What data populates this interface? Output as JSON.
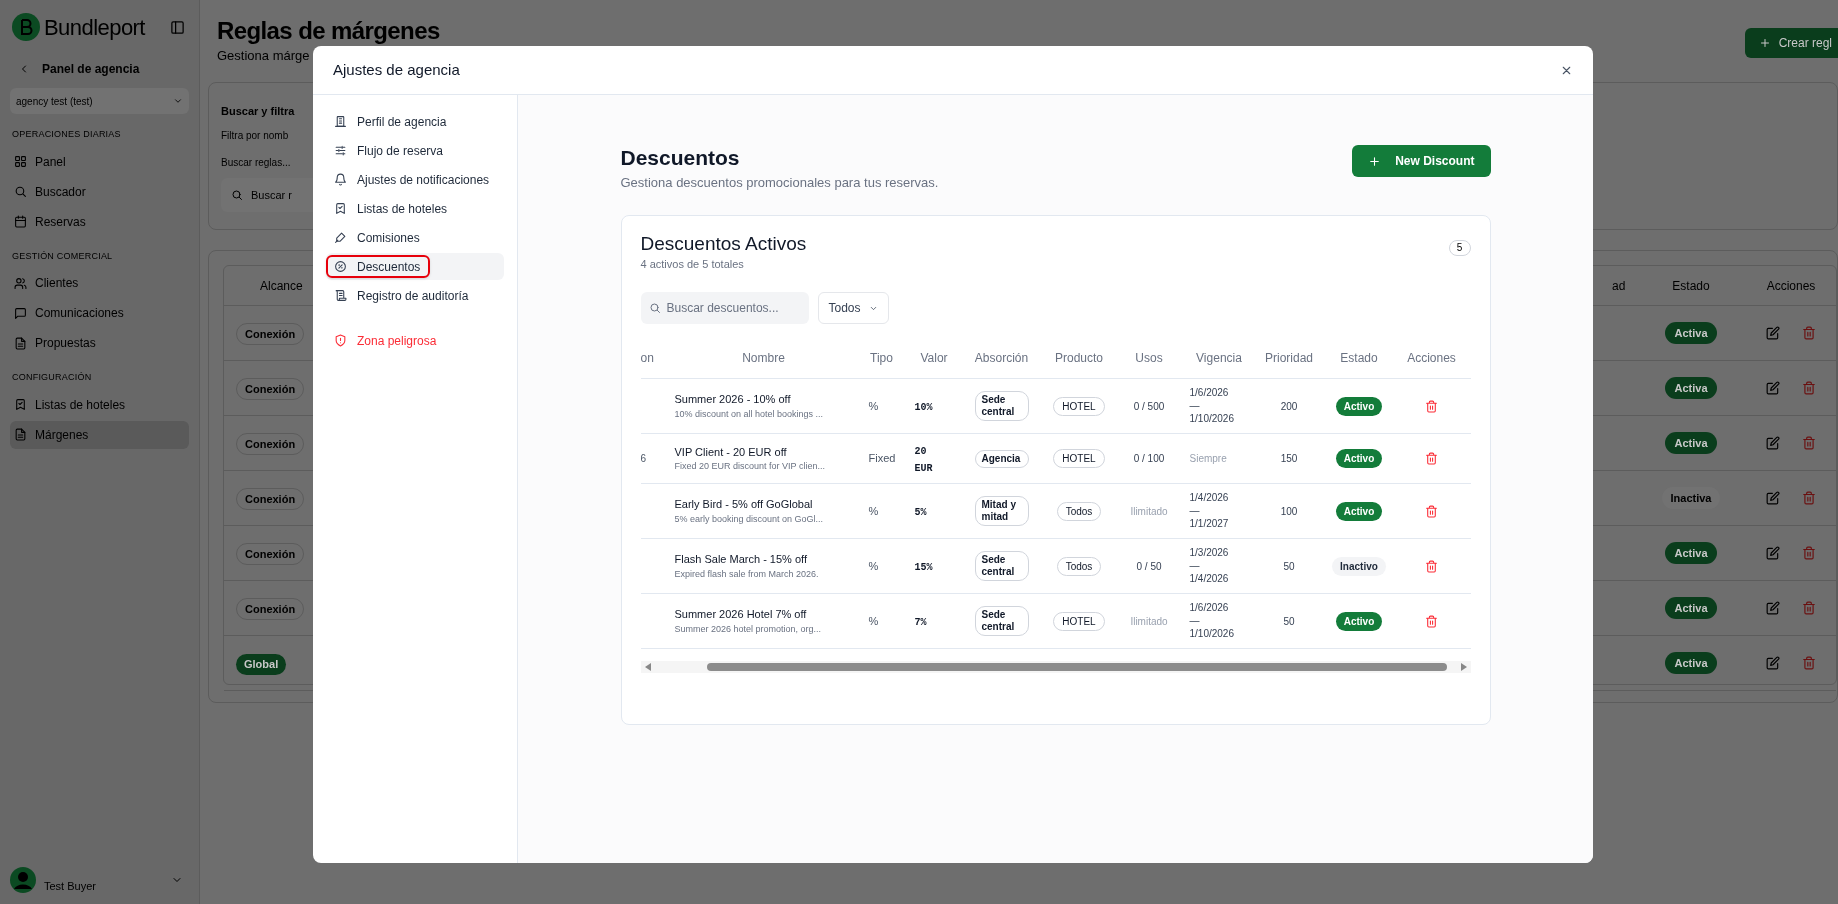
{
  "background": {
    "brand": "Bundleport",
    "back_link": "Panel de agencia",
    "agency_select": "agency test (test)",
    "nav_sections": [
      {
        "title": "OPERACIONES DIARIAS",
        "items": [
          {
            "label": "Panel",
            "selected": false
          },
          {
            "label": "Buscador",
            "selected": false
          },
          {
            "label": "Reservas",
            "selected": false
          }
        ]
      },
      {
        "title": "GESTIÓN COMERCIAL",
        "items": [
          {
            "label": "Clientes",
            "selected": false
          },
          {
            "label": "Comunicaciones",
            "selected": false
          },
          {
            "label": "Propuestas",
            "selected": false
          }
        ]
      },
      {
        "title": "CONFIGURACIÓN",
        "items": [
          {
            "label": "Listas de hoteles",
            "selected": false
          },
          {
            "label": "Márgenes",
            "selected": true
          }
        ]
      }
    ],
    "user": "Test Buyer",
    "title": "Reglas de márgenes",
    "subtitle": "Gestiona márge",
    "create_button": "Crear regl",
    "filter_card": {
      "title": "Buscar y filtra",
      "subtitle": "Filtra por nomb",
      "label": "Buscar reglas...",
      "placeholder": "Buscar r"
    },
    "table": {
      "columns": [
        "Alcance",
        "ad",
        "Estado",
        "Acciones"
      ],
      "rows": [
        {
          "scope": "Conexión",
          "global": false,
          "status": "Activa",
          "active": true
        },
        {
          "scope": "Conexión",
          "global": false,
          "status": "Activa",
          "active": true
        },
        {
          "scope": "Conexión",
          "global": false,
          "status": "Activa",
          "active": true
        },
        {
          "scope": "Conexión",
          "global": false,
          "status": "Inactiva",
          "active": false
        },
        {
          "scope": "Conexión",
          "global": false,
          "status": "Activa",
          "active": true
        },
        {
          "scope": "Conexión",
          "global": false,
          "status": "Activa",
          "active": true
        },
        {
          "scope": "Global",
          "global": true,
          "status": "Activa",
          "active": true
        }
      ]
    }
  },
  "dialog": {
    "title": "Ajustes de agencia",
    "menu": [
      {
        "label": "Perfil de agencia",
        "selected": false,
        "danger": false
      },
      {
        "label": "Flujo de reserva",
        "selected": false,
        "danger": false
      },
      {
        "label": "Ajustes de notificaciones",
        "selected": false,
        "danger": false
      },
      {
        "label": "Listas de hoteles",
        "selected": false,
        "danger": false
      },
      {
        "label": "Comisiones",
        "selected": false,
        "danger": false
      },
      {
        "label": "Descuentos",
        "selected": true,
        "danger": false
      },
      {
        "label": "Registro de auditoría",
        "selected": false,
        "danger": false
      },
      {
        "label": "Zona peligrosa",
        "selected": false,
        "danger": true
      }
    ],
    "heading": "Descuentos",
    "description": "Gestiona descuentos promocionales para tus reservas.",
    "new_button": "New Discount",
    "card": {
      "title": "Descuentos Activos",
      "summary": "4 activos de 5 totales",
      "count": "5",
      "search_placeholder": "Buscar descuentos...",
      "filter": "Todos",
      "columns": [
        "on",
        "Nombre",
        "Tipo",
        "Valor",
        "Absorción",
        "Producto",
        "Usos",
        "Vigencia",
        "Prioridad",
        "Estado",
        "Acciones"
      ],
      "rows": [
        {
          "column_1": "",
          "name": "Summer 2026 - 10% off",
          "description": "10% discount on all hotel bookings ...",
          "type": "%",
          "value": "10%",
          "absorption": "Sede central",
          "product": "HOTEL",
          "uses": "0 / 500",
          "uses_unlimited": false,
          "validity": [
            "1/6/2026",
            "—",
            "1/10/2026"
          ],
          "validity_always": false,
          "priority": "200",
          "status": "Activo",
          "active": true
        },
        {
          "column_1": "6",
          "name": "VIP Client - 20 EUR off",
          "description": "Fixed 20 EUR discount for VIP clien...",
          "type": "Fixed",
          "value": "20 EUR",
          "absorption": "Agencia",
          "product": "HOTEL",
          "uses": "0 / 100",
          "uses_unlimited": false,
          "validity": [
            "Siempre"
          ],
          "validity_always": true,
          "priority": "150",
          "status": "Activo",
          "active": true
        },
        {
          "column_1": "",
          "name": "Early Bird - 5% off GoGlobal",
          "description": "5% early booking discount on GoGl...",
          "type": "%",
          "value": "5%",
          "absorption": "Mitad y mitad",
          "product": "Todos",
          "uses": "Ilimitado",
          "uses_unlimited": true,
          "validity": [
            "1/4/2026",
            "—",
            "1/1/2027"
          ],
          "validity_always": false,
          "priority": "100",
          "status": "Activo",
          "active": true
        },
        {
          "column_1": "",
          "name": "Flash Sale March - 15% off",
          "description": "Expired flash sale from March 2026.",
          "type": "%",
          "value": "15%",
          "absorption": "Sede central",
          "product": "Todos",
          "uses": "0 / 50",
          "uses_unlimited": false,
          "validity": [
            "1/3/2026",
            "—",
            "1/4/2026"
          ],
          "validity_always": false,
          "priority": "50",
          "status": "Inactivo",
          "active": false
        },
        {
          "column_1": "",
          "name": "Summer 2026 Hotel 7% off",
          "description": "Summer 2026 hotel promotion, org...",
          "type": "%",
          "value": "7%",
          "absorption": "Sede central",
          "product": "HOTEL",
          "uses": "Ilimitado",
          "uses_unlimited": true,
          "validity": [
            "1/6/2026",
            "—",
            "1/10/2026"
          ],
          "validity_always": false,
          "priority": "50",
          "status": "Activo",
          "active": true
        }
      ]
    }
  }
}
